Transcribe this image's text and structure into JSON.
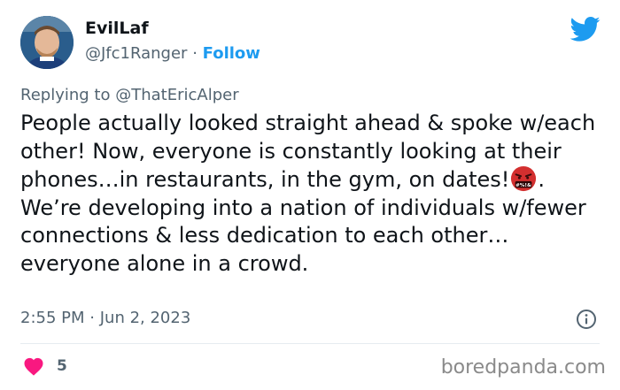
{
  "user": {
    "name": "EvilLaf",
    "handle": "@Jfc1Ranger",
    "separator": "·",
    "follow_label": "Follow"
  },
  "reply": {
    "prefix": "Replying to",
    "mention": "@ThatEricAlper"
  },
  "tweet": {
    "line1": "People actually looked straight ahead & spoke w/each other! Now, everyone is constantly looking at their phones…in restaurants, in the gym, on dates!",
    "line1_end": ".",
    "line2": "We’re developing into a nation of individuals w/fewer  connections & less dedication to each other…everyone alone in a crowd."
  },
  "meta": {
    "time": "2:55 PM",
    "separator": "·",
    "date": "Jun 2, 2023"
  },
  "engagement": {
    "likes": "5"
  },
  "watermark": "boredpanda.com",
  "colors": {
    "twitter_blue": "#1d9bf0",
    "like_pink": "#f91880",
    "secondary_text": "#536471"
  },
  "icons": {
    "bird": "twitter-bird-icon",
    "info": "info-icon",
    "heart": "heart-icon",
    "emoji": "angry-face-with-symbols-emoji"
  }
}
